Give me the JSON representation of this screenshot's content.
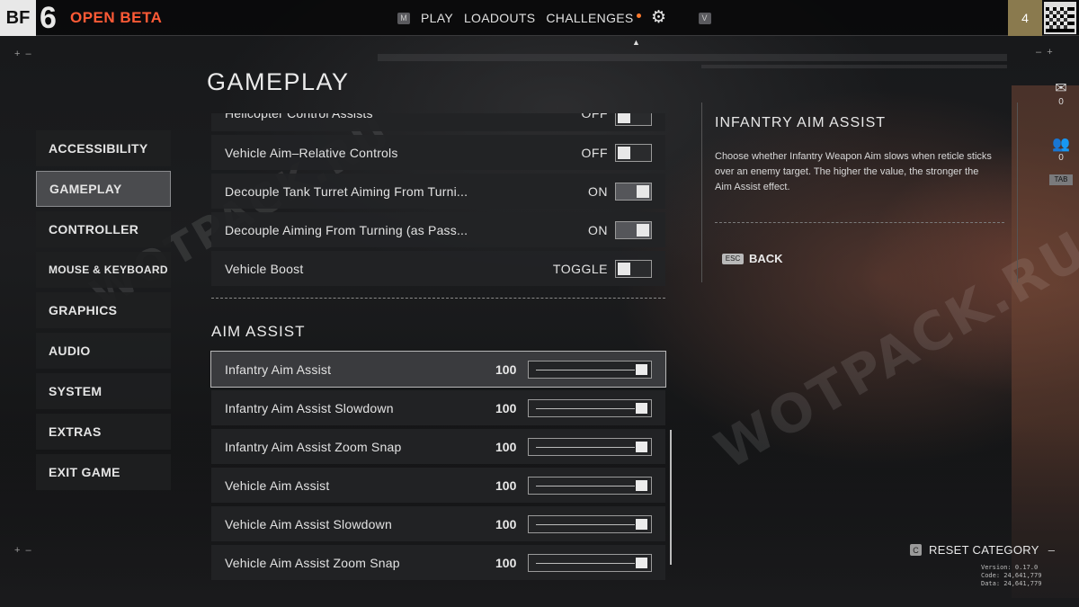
{
  "topbar": {
    "logo_bf": "BF",
    "logo_six": "6",
    "beta_label": "OPEN BETA",
    "nav_left_key": "M",
    "nav_items": [
      "PLAY",
      "LOADOUTS",
      "CHALLENGES"
    ],
    "nav_right_key": "V",
    "level": "4",
    "accent_color": "#ff5a36"
  },
  "page": {
    "title": "GAMEPLAY"
  },
  "side_menu": {
    "items": [
      "ACCESSIBILITY",
      "GAMEPLAY",
      "CONTROLLER",
      "MOUSE & KEYBOARD",
      "GRAPHICS",
      "AUDIO",
      "SYSTEM",
      "EXTRAS",
      "EXIT GAME"
    ],
    "active": "GAMEPLAY"
  },
  "vehicle_settings": {
    "rows": [
      {
        "label": "Helicopter Control Assists",
        "value": "OFF",
        "state": "off"
      },
      {
        "label": "Vehicle Aim–Relative Controls",
        "value": "OFF",
        "state": "off"
      },
      {
        "label": "Decouple Tank Turret Aiming From Turni...",
        "value": "ON",
        "state": "on"
      },
      {
        "label": "Decouple Aiming From Turning (as Pass...",
        "value": "ON",
        "state": "on"
      },
      {
        "label": "Vehicle Boost",
        "value": "TOGGLE",
        "state": "off"
      }
    ]
  },
  "aim_assist": {
    "section_title": "AIM ASSIST",
    "rows": [
      {
        "label": "Infantry Aim Assist",
        "value": "100",
        "level": 1.0
      },
      {
        "label": "Infantry Aim Assist Slowdown",
        "value": "100",
        "level": 1.0
      },
      {
        "label": "Infantry Aim Assist Zoom Snap",
        "value": "100",
        "level": 1.0
      },
      {
        "label": "Vehicle Aim Assist",
        "value": "100",
        "level": 1.0
      },
      {
        "label": "Vehicle Aim Assist Slowdown",
        "value": "100",
        "level": 1.0
      },
      {
        "label": "Vehicle Aim Assist Zoom Snap",
        "value": "100",
        "level": 1.0
      }
    ],
    "selected": "Infantry Aim Assist"
  },
  "info_panel": {
    "title": "INFANTRY AIM ASSIST",
    "description": "Choose whether Infantry Weapon Aim slows when reticle sticks over an enemy target. The higher the value, the stronger the Aim Assist effect.",
    "back_key": "ESC",
    "back_label": "BACK"
  },
  "hud": {
    "mail_count": "0",
    "squad_count": "0",
    "tab_key": "TAB"
  },
  "footer": {
    "reset_key": "C",
    "reset_label": "RESET CATEGORY",
    "version_lines": [
      "Version: 0.17.0",
      "Code: 24,641,779",
      "Data: 24,641,779"
    ]
  },
  "watermark": "WOTPACK.RU",
  "icons": {
    "gear": "gear-icon",
    "mail": "mail-icon",
    "squad": "squad-icon"
  }
}
